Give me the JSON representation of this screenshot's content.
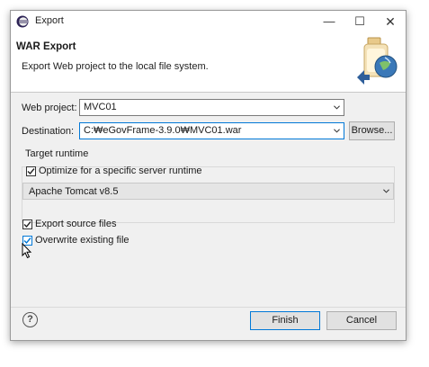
{
  "window": {
    "title": "Export",
    "controls": {
      "minimize": "—",
      "maximize": "☐",
      "close": "✕"
    }
  },
  "header": {
    "title": "WAR Export",
    "description": "Export Web project to the local file system."
  },
  "form": {
    "web_project_label": "Web project:",
    "web_project_value": "MVC01",
    "destination_label": "Destination:",
    "destination_value": "C:₩eGovFrame-3.9.0₩MVC01.war",
    "browse_label": "Browse..."
  },
  "target_runtime": {
    "group_label": "Target runtime",
    "optimize_label": "Optimize for a specific server runtime",
    "optimize_checked": true,
    "runtime_value": "Apache Tomcat v8.5"
  },
  "options": {
    "export_source_label": "Export source files",
    "export_source_checked": true,
    "overwrite_label": "Overwrite existing file",
    "overwrite_checked": true
  },
  "footer": {
    "help_glyph": "?",
    "finish_label": "Finish",
    "cancel_label": "Cancel"
  },
  "colors": {
    "dialog_bg": "#f0f0f0",
    "header_bg": "#ffffff",
    "focus_blue": "#0078d7",
    "button_bg": "#e1e1e1"
  }
}
